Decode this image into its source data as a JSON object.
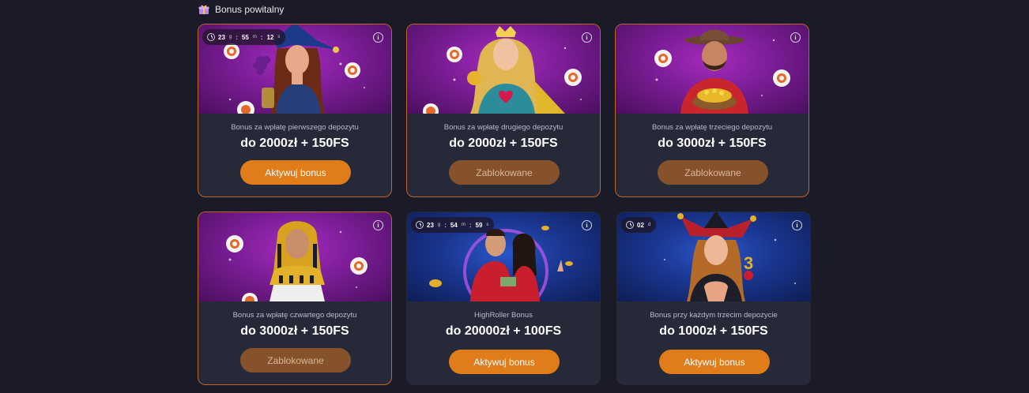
{
  "section": {
    "title": "Bonus powitalny",
    "icon": "gift-icon"
  },
  "colors": {
    "accent": "#e07c1a",
    "locked": "#86522c",
    "card_bg": "#262938",
    "page_bg": "#1a1b27"
  },
  "cards": [
    {
      "subtitle": "Bonus za wpłatę pierwszego depozytu",
      "amount": "do 2000zł + 150FS",
      "button": "Aktywuj bonus",
      "state": "active",
      "timer": {
        "d": "23",
        "du": "g",
        "h": "55",
        "hu": "m",
        "m": "12",
        "mu": "s"
      }
    },
    {
      "subtitle": "Bonus za wpłatę drugiego depozytu",
      "amount": "do 2000zł + 150FS",
      "button": "Zablokowane",
      "state": "locked"
    },
    {
      "subtitle": "Bonus za wpłatę trzeciego depozytu",
      "amount": "do 3000zł + 150FS",
      "button": "Zablokowane",
      "state": "locked"
    },
    {
      "subtitle": "Bonus za wpłatę czwartego depozytu",
      "amount": "do 3000zł + 150FS",
      "button": "Zablokowane",
      "state": "locked"
    },
    {
      "subtitle": "HighRoller Bonus",
      "amount": "do 20000zł + 100FS",
      "button": "Aktywuj bonus",
      "state": "active",
      "timer": {
        "d": "23",
        "du": "g",
        "h": "54",
        "hu": "m",
        "m": "59",
        "mu": "s"
      }
    },
    {
      "subtitle": "Bonus przy każdym trzecim depozycie",
      "amount": "do 1000zł + 150FS",
      "button": "Aktywuj bonus",
      "state": "active",
      "timer": {
        "d": "02",
        "du": "d"
      }
    }
  ]
}
